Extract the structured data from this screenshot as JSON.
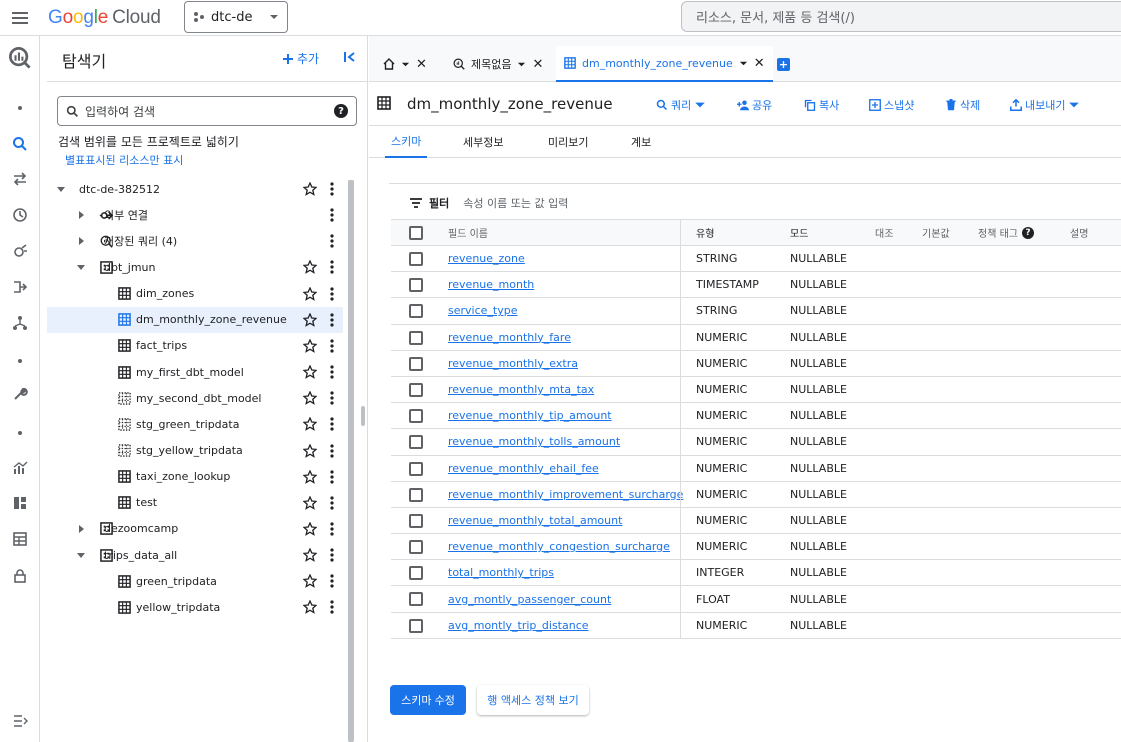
{
  "topbar": {
    "logo": {
      "g": "G",
      "o1": "o",
      "o2": "o",
      "g2": "g",
      "l": "l",
      "e": "e",
      "cloud": "Cloud"
    },
    "project": "dtc-de",
    "search_placeholder": "리소스, 문서, 제품 등 검색(/)"
  },
  "explorer": {
    "title": "탐색기",
    "add_label": "추가",
    "search_placeholder": "입력하여 검색",
    "scope_text": "검색 범위를 모든 프로젝트로 넓히기",
    "starred_link": "별표표시된 리소스만 표시",
    "tree": [
      {
        "label": "dtc-de-382512",
        "kind": "project",
        "expanded": true
      },
      {
        "label": "외부 연결",
        "kind": "connection",
        "expanded": false
      },
      {
        "label": "저장된 쿼리 (4)",
        "kind": "queries",
        "expanded": false
      },
      {
        "label": "dbt_jmun",
        "kind": "dataset",
        "expanded": true
      },
      {
        "label": "dim_zones",
        "kind": "table"
      },
      {
        "label": "dm_monthly_zone_revenue",
        "kind": "table",
        "selected": true
      },
      {
        "label": "fact_trips",
        "kind": "table"
      },
      {
        "label": "my_first_dbt_model",
        "kind": "table"
      },
      {
        "label": "my_second_dbt_model",
        "kind": "view"
      },
      {
        "label": "stg_green_tripdata",
        "kind": "view"
      },
      {
        "label": "stg_yellow_tripdata",
        "kind": "view"
      },
      {
        "label": "taxi_zone_lookup",
        "kind": "table"
      },
      {
        "label": "test",
        "kind": "table"
      },
      {
        "label": "dezoomcamp",
        "kind": "dataset",
        "expanded": false
      },
      {
        "label": "trips_data_all",
        "kind": "dataset",
        "expanded": true
      },
      {
        "label": "green_tripdata",
        "kind": "table"
      },
      {
        "label": "yellow_tripdata",
        "kind": "table"
      }
    ]
  },
  "tabs": {
    "home_label": "",
    "untitled_label": "제목없음",
    "active_label": "dm_monthly_zone_revenue"
  },
  "resource": {
    "title": "dm_monthly_zone_revenue",
    "actions": {
      "query": "쿼리",
      "share": "공유",
      "copy": "복사",
      "snapshot": "스냅샷",
      "delete": "삭제",
      "export": "내보내기"
    },
    "subtabs": {
      "schema": "스키마",
      "details": "세부정보",
      "preview": "미리보기",
      "lineage": "계보"
    }
  },
  "filter": {
    "label": "필터",
    "placeholder": "속성 이름 또는 값 입력"
  },
  "schema": {
    "headers": {
      "name": "필드 이름",
      "type": "유형",
      "mode": "모드",
      "collation": "대조",
      "default": "기본값",
      "policy_tags": "정책 태그",
      "description": "설명"
    },
    "fields": [
      {
        "name": "revenue_zone",
        "type": "STRING",
        "mode": "NULLABLE"
      },
      {
        "name": "revenue_month",
        "type": "TIMESTAMP",
        "mode": "NULLABLE"
      },
      {
        "name": "service_type",
        "type": "STRING",
        "mode": "NULLABLE"
      },
      {
        "name": "revenue_monthly_fare",
        "type": "NUMERIC",
        "mode": "NULLABLE"
      },
      {
        "name": "revenue_monthly_extra",
        "type": "NUMERIC",
        "mode": "NULLABLE"
      },
      {
        "name": "revenue_monthly_mta_tax",
        "type": "NUMERIC",
        "mode": "NULLABLE"
      },
      {
        "name": "revenue_monthly_tip_amount",
        "type": "NUMERIC",
        "mode": "NULLABLE"
      },
      {
        "name": "revenue_monthly_tolls_amount",
        "type": "NUMERIC",
        "mode": "NULLABLE"
      },
      {
        "name": "revenue_monthly_ehail_fee",
        "type": "NUMERIC",
        "mode": "NULLABLE"
      },
      {
        "name": "revenue_monthly_improvement_surcharge",
        "type": "NUMERIC",
        "mode": "NULLABLE"
      },
      {
        "name": "revenue_monthly_total_amount",
        "type": "NUMERIC",
        "mode": "NULLABLE"
      },
      {
        "name": "revenue_monthly_congestion_surcharge",
        "type": "NUMERIC",
        "mode": "NULLABLE"
      },
      {
        "name": "total_monthly_trips",
        "type": "INTEGER",
        "mode": "NULLABLE"
      },
      {
        "name": "avg_montly_passenger_count",
        "type": "FLOAT",
        "mode": "NULLABLE"
      },
      {
        "name": "avg_montly_trip_distance",
        "type": "NUMERIC",
        "mode": "NULLABLE"
      }
    ]
  },
  "buttons": {
    "edit_schema": "스키마 수정",
    "row_access": "행 액세스 정책 보기"
  },
  "colors": {
    "accent": "#1a73e8",
    "selected_bg": "#e8f0fe"
  },
  "icons": {
    "rail": [
      "bigquery-logo-icon",
      "dot-icon",
      "search-icon",
      "transfer-icon",
      "history-icon",
      "analytics-hub-icon",
      "pipeline-icon",
      "dataflow-icon",
      "dot-icon",
      "wrench-icon",
      "dot-icon",
      "chart-icon",
      "dashboard-icon",
      "table-icon",
      "lock-icon"
    ]
  }
}
